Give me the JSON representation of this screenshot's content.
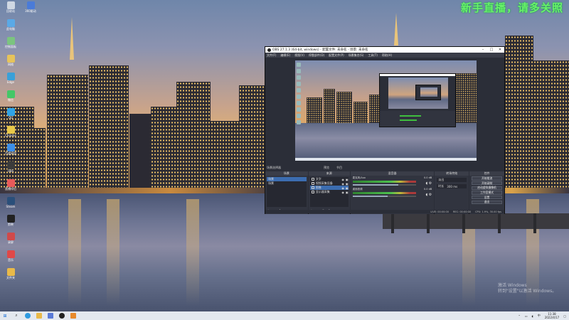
{
  "watermark_top": "新手直播，请多关照",
  "activate_windows": {
    "title": "激活 Windows",
    "subtitle": "转到\"设置\"以激活 Windows。"
  },
  "desktop_icons": [
    {
      "name": "recycle-bin-icon",
      "label": "回收站",
      "color": "#cfd8e3"
    },
    {
      "name": "app-icon",
      "label": "此电脑",
      "color": "#5aa9e6"
    },
    {
      "name": "app-icon",
      "label": "控制面板",
      "color": "#7bc47f"
    },
    {
      "name": "app-icon",
      "label": "网络",
      "color": "#e6c35a"
    },
    {
      "name": "app-icon",
      "label": "Edge",
      "color": "#3aa0d8"
    },
    {
      "name": "app-icon",
      "label": "微信",
      "color": "#44c767"
    },
    {
      "name": "app-icon",
      "label": "QQ",
      "color": "#2fa3e6"
    },
    {
      "name": "app-icon",
      "label": "Chrome",
      "color": "#e8c84a"
    },
    {
      "name": "app-icon",
      "label": "百度网盘",
      "color": "#3c8ee8"
    },
    {
      "name": "app-icon",
      "label": "OBS",
      "color": "#3b3b3b"
    },
    {
      "name": "app-icon",
      "label": "直播伴侣",
      "color": "#e85a5a"
    },
    {
      "name": "app-icon",
      "label": "Steam",
      "color": "#2a4f7a"
    },
    {
      "name": "app-icon",
      "label": "剪映",
      "color": "#222222"
    },
    {
      "name": "app-icon",
      "label": "录屏",
      "color": "#d04a4a"
    },
    {
      "name": "app-icon",
      "label": "音乐",
      "color": "#e04848"
    },
    {
      "name": "app-icon",
      "label": "文件夹",
      "color": "#e9b949"
    }
  ],
  "desktop_icon_col2": {
    "label": "360驱动",
    "color": "#4a7bd8"
  },
  "obs": {
    "title": "OBS 27.1.3 (64-bit, windows) - 配置文件: 未命名 - 场景: 未命名",
    "menu": [
      "文件(F)",
      "编辑(E)",
      "视图(V)",
      "停靠部件(D)",
      "配置文件(P)",
      "场景集合(S)",
      "工具(T)",
      "帮助(H)"
    ],
    "dock_tab_label": "场景选择器",
    "preview_tabs": [
      "预览",
      "节目"
    ],
    "scenes": {
      "title": "场景",
      "items": [
        "场景",
        "场景"
      ]
    },
    "sources": {
      "title": "来源",
      "items": [
        {
          "label": "文字",
          "selected": false
        },
        {
          "label": "视频采集设备",
          "selected": false
        },
        {
          "label": "图像",
          "selected": true
        },
        {
          "label": "显示器采集",
          "selected": false
        }
      ]
    },
    "mixer": {
      "title": "混音器",
      "channels": [
        {
          "name": "麦克风/Aux",
          "db": "0.0 dB",
          "level": 0.72
        },
        {
          "name": "桌面音频",
          "db": "0.0 dB",
          "level": 0.55
        }
      ]
    },
    "transitions": {
      "title": "转场特效",
      "type": "淡出",
      "duration_label": "时长",
      "duration": "300 ms"
    },
    "controls": {
      "title": "控件",
      "buttons": [
        "开始推流",
        "开始录制",
        "启动虚拟摄像机",
        "工作室模式",
        "设置",
        "退出"
      ]
    },
    "status": [
      "LIVE: 00:00:00",
      "REC: 00:00:00",
      "CPU: 1.9%, 30.00 fps"
    ]
  },
  "taskbar": {
    "apps": [
      "start",
      "search",
      "edge",
      "explorer",
      "store",
      "obs",
      "app"
    ],
    "time": "11:38",
    "date": "2022/4/17",
    "lang": "中"
  }
}
